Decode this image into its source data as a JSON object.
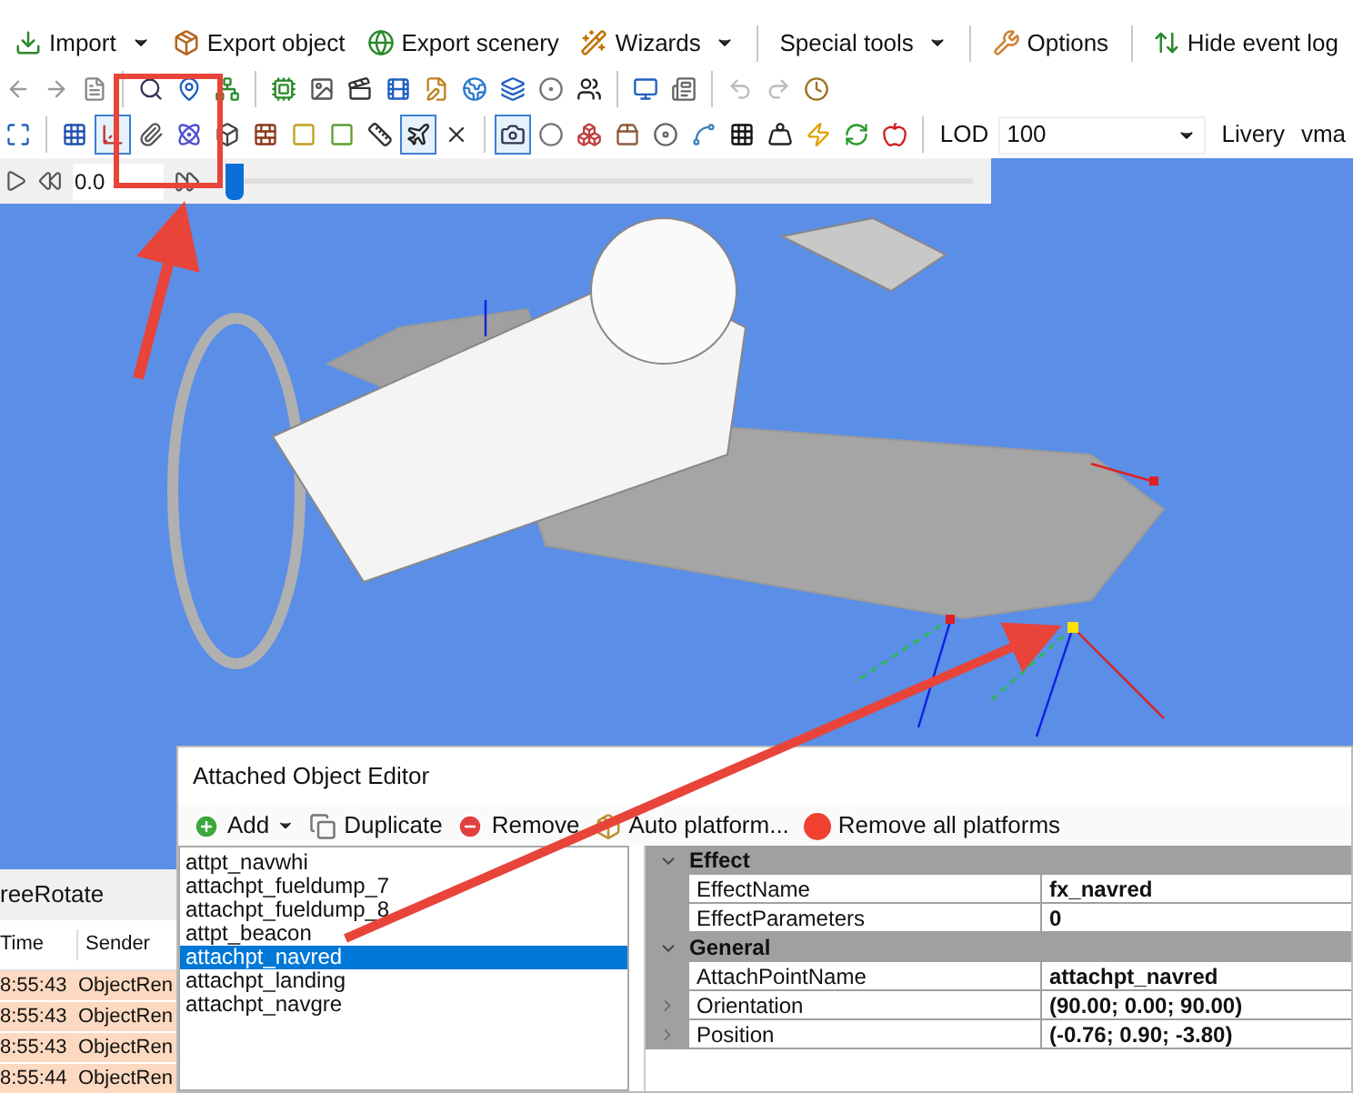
{
  "menu_toolbar": [
    {
      "label": "Import",
      "dropdown": true
    },
    {
      "label": "Export object",
      "dropdown": false
    },
    {
      "label": "Export scenery",
      "dropdown": false
    },
    {
      "label": "Wizards",
      "dropdown": true
    },
    {
      "label": "Special tools",
      "dropdown": true
    },
    {
      "label": "Options",
      "dropdown": false
    },
    {
      "label": "Hide event log",
      "dropdown": false
    }
  ],
  "view_tools": [
    {
      "pressed": false
    },
    {
      "pressed": false
    },
    {
      "pressed": true
    },
    {
      "pressed": false
    },
    {
      "pressed": false
    },
    {
      "pressed": false
    },
    {
      "pressed": false
    },
    {
      "pressed": false
    },
    {
      "pressed": false
    },
    {
      "pressed": false
    },
    {
      "pressed": true
    },
    {
      "pressed": false
    },
    {
      "pressed": true
    },
    {
      "pressed": false
    },
    {
      "pressed": false
    },
    {
      "pressed": false
    },
    {
      "pressed": false
    },
    {
      "pressed": false
    },
    {
      "pressed": false
    },
    {
      "pressed": false
    },
    {
      "pressed": false
    }
  ],
  "lod": {
    "label": "LOD",
    "value": "100"
  },
  "livery": {
    "label": "Livery",
    "value": "vma"
  },
  "timeline": {
    "time": "0.0",
    "level": 0.0
  },
  "event_log": {
    "title": "reeRotate",
    "columns": [
      "Time",
      "Sender"
    ],
    "rows": [
      [
        "8:55:43",
        "ObjectRen"
      ],
      [
        "8:55:43",
        "ObjectRen"
      ],
      [
        "8:55:43",
        "ObjectRen"
      ],
      [
        "8:55:44",
        "ObjectRen"
      ]
    ]
  },
  "editor": {
    "title": "Attached Object Editor",
    "toolbar": [
      {
        "label": "Add",
        "kind": "add",
        "dropdown": true
      },
      {
        "label": "Duplicate",
        "kind": "duplicate",
        "dropdown": false
      },
      {
        "label": "Remove",
        "kind": "remove",
        "dropdown": false
      },
      {
        "label": "Auto platform...",
        "kind": "auto",
        "dropdown": false
      },
      {
        "label": "Remove all platforms",
        "kind": "remove_all",
        "dropdown": false
      }
    ],
    "items": [
      {
        "label": "attpt_navwhi",
        "selected": false
      },
      {
        "label": "attachpt_fueldump_7",
        "selected": false
      },
      {
        "label": "attachpt_fueldump_8",
        "selected": false
      },
      {
        "label": "attpt_beacon",
        "selected": false
      },
      {
        "label": "attachpt_navred",
        "selected": true
      },
      {
        "label": "attachpt_landing",
        "selected": false
      },
      {
        "label": "attachpt_navgre",
        "selected": false
      }
    ],
    "properties": [
      {
        "category": "Effect",
        "expanded": true,
        "rows": [
          {
            "name": "EffectName",
            "value": "fx_navred",
            "expandable": false
          },
          {
            "name": "EffectParameters",
            "value": "0",
            "expandable": false
          }
        ]
      },
      {
        "category": "General",
        "expanded": true,
        "rows": [
          {
            "name": "AttachPointName",
            "value": "attachpt_navred",
            "expandable": false
          },
          {
            "name": "Orientation",
            "value": "(90.00; 0.00; 90.00)",
            "expandable": true
          },
          {
            "name": "Position",
            "value": "(-0.76; 0.90; -3.80)",
            "expandable": true
          }
        ]
      }
    ]
  }
}
